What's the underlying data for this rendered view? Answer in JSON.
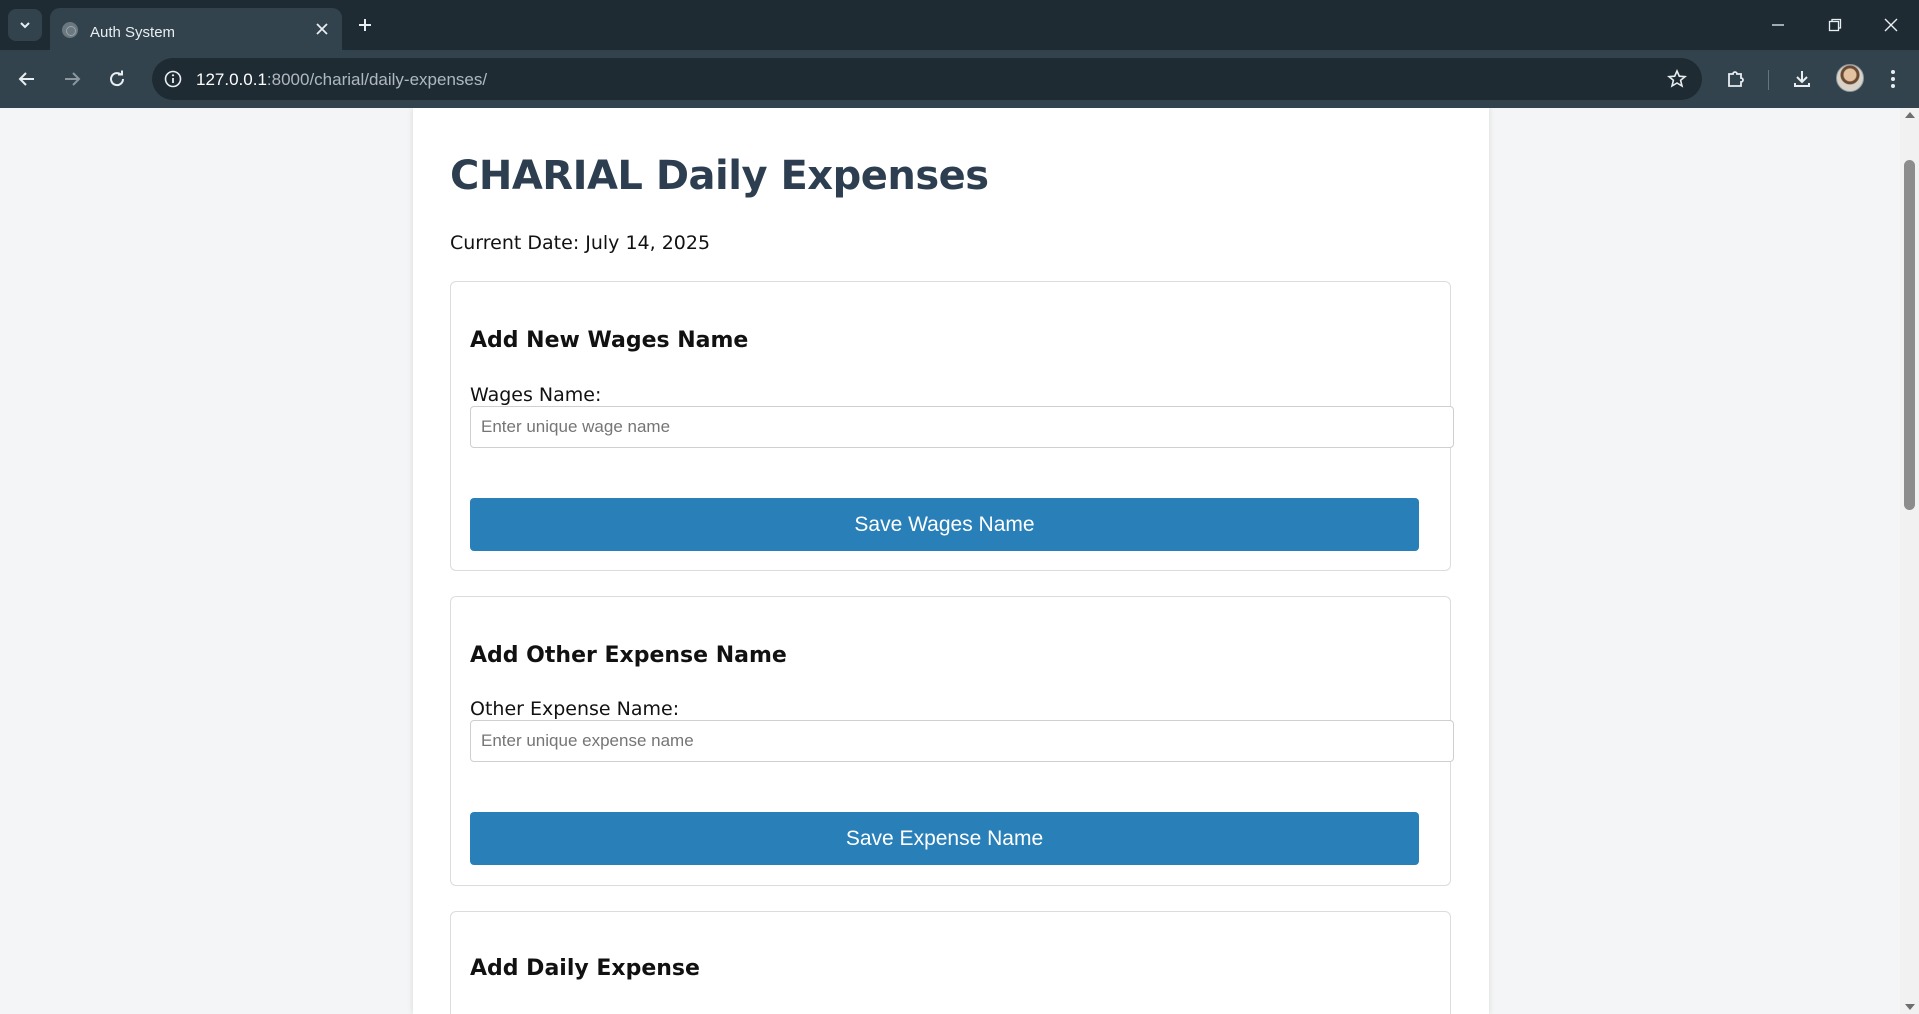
{
  "browser": {
    "tab_title": "Auth System",
    "url_host": "127.0.0.1",
    "url_path": ":8000/charial/daily-expenses/"
  },
  "page": {
    "title": "CHARIAL Daily Expenses",
    "current_date": "Current Date: July 14, 2025"
  },
  "wages_form": {
    "heading": "Add New Wages Name",
    "label": "Wages Name:",
    "placeholder": "Enter unique wage name",
    "value": "",
    "button": "Save Wages Name"
  },
  "other_expense_form": {
    "heading": "Add Other Expense Name",
    "label": "Other Expense Name:",
    "placeholder": "Enter unique expense name",
    "value": "",
    "button": "Save Expense Name"
  },
  "daily_expense_form": {
    "heading": "Add Daily Expense"
  },
  "colors": {
    "title": "#2c3e50",
    "button": "#2980b9",
    "chrome_dark": "#1f2b33",
    "chrome_toolbar": "#33434d"
  }
}
